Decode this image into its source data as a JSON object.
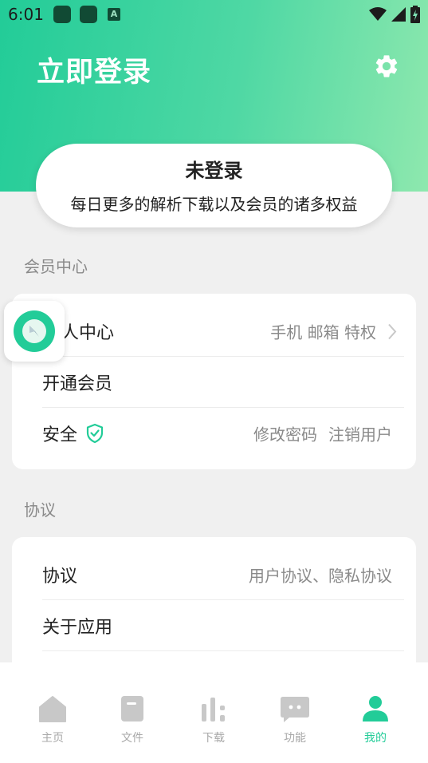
{
  "status_bar": {
    "time": "6:01",
    "notif_a": "A"
  },
  "header": {
    "title": "立即登录"
  },
  "login_card": {
    "status": "未登录",
    "description": "每日更多的解析下载以及会员的诸多权益"
  },
  "member_section": {
    "title": "会员中心",
    "rows": [
      {
        "label": "个人中心",
        "visible_label": "人中心",
        "right_text": "手机 邮箱 特权"
      },
      {
        "label": "开通会员"
      },
      {
        "label": "安全",
        "links": [
          "修改密码",
          "注销用户"
        ]
      }
    ]
  },
  "agreement_section": {
    "title": "协议",
    "rows": [
      {
        "label": "协议",
        "right_text": "用户协议、隐私协议"
      },
      {
        "label": "关于应用"
      }
    ]
  },
  "bottom_nav": {
    "items": [
      {
        "label": "主页",
        "icon": "home-icon"
      },
      {
        "label": "文件",
        "icon": "file-icon"
      },
      {
        "label": "下载",
        "icon": "download-icon"
      },
      {
        "label": "功能",
        "icon": "chat-icon"
      },
      {
        "label": "我的",
        "icon": "user-icon",
        "active": true
      }
    ]
  },
  "colors": {
    "accent": "#22cc98",
    "gradient_end": "#8ee8ae",
    "inactive": "#a8a8a8",
    "background": "#f0f0f0"
  }
}
